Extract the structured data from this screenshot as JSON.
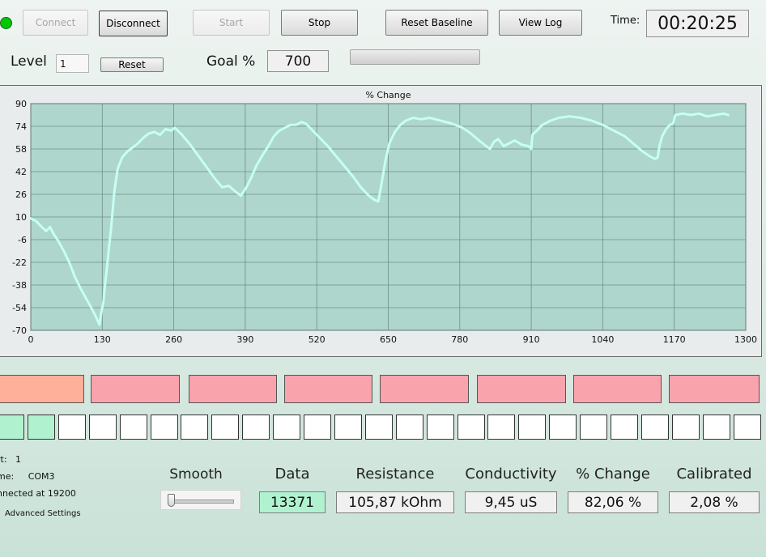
{
  "toolbar": {
    "connect_label": "Connect",
    "disconnect_label": "Disconnect",
    "start_label": "Start",
    "stop_label": "Stop",
    "reset_baseline_label": "Reset Baseline",
    "view_log_label": "View Log",
    "time_label": "Time:",
    "time_value": "00:20:25",
    "status_color": "#00c800"
  },
  "controls": {
    "level_label": "Level",
    "level_value": "1",
    "reset_label": "Reset",
    "goal_label": "Goal %",
    "goal_value": "700",
    "goal_progress": 0
  },
  "chart_data": {
    "type": "line",
    "title": "% Change",
    "xlabel": "",
    "ylabel": "",
    "xlim": [
      0,
      1300
    ],
    "ylim": [
      -70,
      90
    ],
    "xticks": [
      0,
      130,
      260,
      390,
      520,
      650,
      780,
      910,
      1040,
      1170,
      1300
    ],
    "yticks": [
      90,
      74,
      58,
      42,
      26,
      10,
      -6,
      -22,
      -38,
      -54,
      -70
    ],
    "grid": true,
    "colors": {
      "background": "#aed6cd",
      "line": "#c6fff4",
      "grid": "#6f8f88"
    },
    "series": [
      {
        "values": [
          [
            0,
            9
          ],
          [
            10,
            7
          ],
          [
            20,
            3
          ],
          [
            28,
            0
          ],
          [
            35,
            3
          ],
          [
            40,
            -1
          ],
          [
            50,
            -7
          ],
          [
            60,
            -14
          ],
          [
            70,
            -22
          ],
          [
            80,
            -32
          ],
          [
            90,
            -40
          ],
          [
            100,
            -47
          ],
          [
            110,
            -54
          ],
          [
            118,
            -60
          ],
          [
            125,
            -66
          ],
          [
            128,
            -58
          ],
          [
            132,
            -50
          ],
          [
            135,
            -38
          ],
          [
            138,
            -28
          ],
          [
            142,
            -12
          ],
          [
            146,
            2
          ],
          [
            152,
            28
          ],
          [
            158,
            44
          ],
          [
            166,
            52
          ],
          [
            175,
            56
          ],
          [
            185,
            59
          ],
          [
            195,
            62
          ],
          [
            205,
            66
          ],
          [
            215,
            69
          ],
          [
            225,
            70
          ],
          [
            235,
            68
          ],
          [
            245,
            72
          ],
          [
            255,
            71
          ],
          [
            262,
            73
          ],
          [
            275,
            68
          ],
          [
            290,
            61
          ],
          [
            305,
            53
          ],
          [
            320,
            45
          ],
          [
            335,
            37
          ],
          [
            348,
            31
          ],
          [
            360,
            32
          ],
          [
            372,
            28
          ],
          [
            382,
            25
          ],
          [
            392,
            31
          ],
          [
            400,
            37
          ],
          [
            410,
            46
          ],
          [
            422,
            54
          ],
          [
            432,
            60
          ],
          [
            442,
            67
          ],
          [
            452,
            71
          ],
          [
            462,
            73
          ],
          [
            472,
            75
          ],
          [
            482,
            75
          ],
          [
            492,
            77
          ],
          [
            500,
            76
          ],
          [
            510,
            72
          ],
          [
            525,
            66
          ],
          [
            540,
            60
          ],
          [
            555,
            53
          ],
          [
            570,
            46
          ],
          [
            585,
            39
          ],
          [
            600,
            31
          ],
          [
            615,
            25
          ],
          [
            625,
            22
          ],
          [
            632,
            21
          ],
          [
            638,
            34
          ],
          [
            645,
            50
          ],
          [
            652,
            62
          ],
          [
            662,
            70
          ],
          [
            672,
            75
          ],
          [
            682,
            78
          ],
          [
            695,
            80
          ],
          [
            710,
            79
          ],
          [
            725,
            80
          ],
          [
            745,
            78
          ],
          [
            765,
            76
          ],
          [
            785,
            73
          ],
          [
            800,
            69
          ],
          [
            815,
            64
          ],
          [
            828,
            60
          ],
          [
            835,
            58
          ],
          [
            842,
            63
          ],
          [
            850,
            65
          ],
          [
            860,
            60
          ],
          [
            870,
            62
          ],
          [
            880,
            64
          ],
          [
            893,
            61
          ],
          [
            905,
            60
          ],
          [
            910,
            58
          ],
          [
            912,
            68
          ],
          [
            920,
            71
          ],
          [
            930,
            75
          ],
          [
            945,
            78
          ],
          [
            960,
            80
          ],
          [
            980,
            81
          ],
          [
            1000,
            80
          ],
          [
            1020,
            78
          ],
          [
            1040,
            75
          ],
          [
            1060,
            71
          ],
          [
            1080,
            67
          ],
          [
            1095,
            62
          ],
          [
            1110,
            57
          ],
          [
            1125,
            53
          ],
          [
            1135,
            51
          ],
          [
            1140,
            52
          ],
          [
            1143,
            60
          ],
          [
            1148,
            67
          ],
          [
            1155,
            72
          ],
          [
            1162,
            75
          ],
          [
            1168,
            76
          ],
          [
            1172,
            82
          ],
          [
            1185,
            83
          ],
          [
            1200,
            82
          ],
          [
            1215,
            83
          ],
          [
            1230,
            81
          ],
          [
            1245,
            82
          ],
          [
            1260,
            83
          ],
          [
            1268,
            82
          ]
        ]
      }
    ]
  },
  "channels": {
    "bars": [
      {
        "color": "#ffb09a"
      },
      {
        "color": "#f9a3ad"
      },
      {
        "color": "#f9a3ad"
      },
      {
        "color": "#f9a3ad"
      },
      {
        "color": "#f9a3ad"
      },
      {
        "color": "#f9a3ad"
      },
      {
        "color": "#f9a3ad"
      },
      {
        "color": "#f9a3ad"
      }
    ],
    "indicators": [
      true,
      true,
      false,
      false,
      false,
      false,
      false,
      false,
      false,
      false,
      false,
      false,
      false,
      false,
      false,
      false,
      false,
      false,
      false,
      false,
      false,
      false,
      false,
      false,
      false
    ]
  },
  "info": {
    "port_label": "rt:",
    "port_value": "1",
    "name_label": "me:",
    "name_value": "COM3",
    "connection_text": "nnected at 19200",
    "advanced_settings_label": "Advanced Settings"
  },
  "readouts": {
    "smooth_label": "Smooth",
    "smooth_value": 0,
    "data_label": "Data",
    "data_value": "13371",
    "resistance_label": "Resistance",
    "resistance_value": "105,87 kOhm",
    "conductivity_label": "Conductivity",
    "conductivity_value": "9,45 uS",
    "pchange_label": "% Change",
    "pchange_value": "82,06 %",
    "calibrated_label": "Calibrated",
    "calibrated_value": "2,08 %"
  }
}
